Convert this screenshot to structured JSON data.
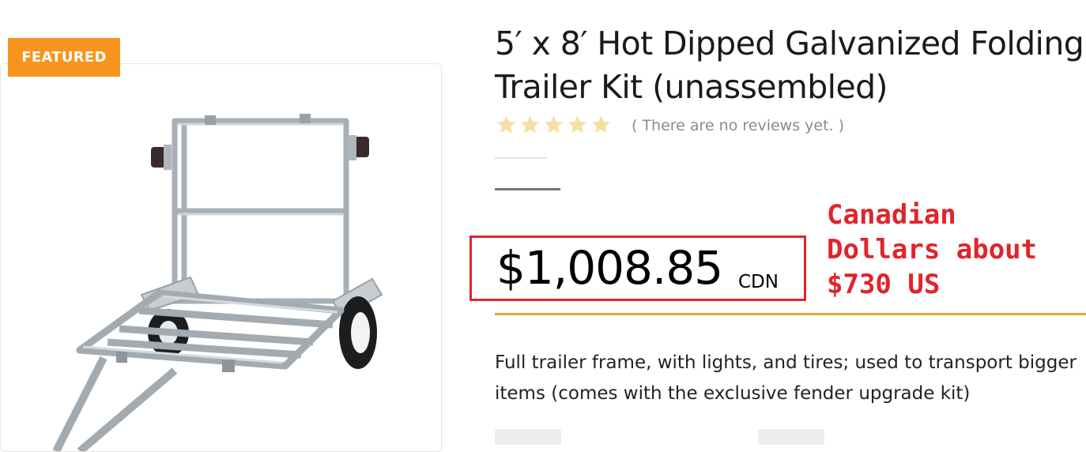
{
  "badge": {
    "label": "FEATURED",
    "color": "#f7941d"
  },
  "product": {
    "title": "5′ x 8′ Hot Dipped Galvanized Folding Trailer Kit (unassembled)",
    "rating_stars": 5,
    "reviews_text": "( There are no reviews yet. )",
    "price": "$1,008.85",
    "currency": "CDN",
    "description": "Full trailer frame, with lights, and tires; used to transport bigger items (comes with the exclusive fender upgrade kit)"
  },
  "annotation": {
    "lines": [
      "Canadian",
      "Dollars about",
      "$730 US"
    ],
    "color": "#e0242c"
  },
  "colors": {
    "star": "#f6dfa4",
    "accent_rule": "#e8a33c",
    "annotation_box": "#e0242c"
  },
  "icons": [
    "star-icon"
  ]
}
